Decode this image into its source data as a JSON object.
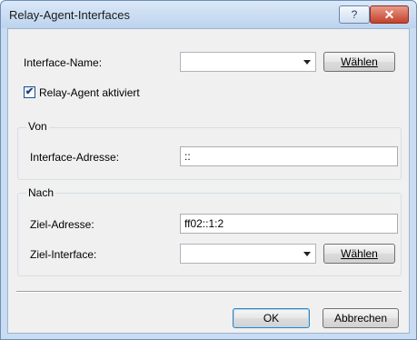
{
  "window": {
    "title": "Relay-Agent-Interfaces",
    "help_label": "?",
    "close_label": "✕"
  },
  "interface_name": {
    "label": "Interface-Name:",
    "value": "",
    "choose_label": "Wählen"
  },
  "relay_agent": {
    "label": "Relay-Agent aktiviert",
    "checked": true,
    "check_glyph": "✔"
  },
  "von": {
    "group_title": "Von",
    "address_label": "Interface-Adresse:",
    "address_value": "::"
  },
  "nach": {
    "group_title": "Nach",
    "target_address_label": "Ziel-Adresse:",
    "target_address_value": "ff02::1:2",
    "target_interface_label": "Ziel-Interface:",
    "target_interface_value": "",
    "choose_label": "Wählen"
  },
  "footer": {
    "ok_label": "OK",
    "cancel_label": "Abbrechen"
  },
  "colors": {
    "title_bar": "#c9dcf2",
    "close_button": "#c4412b",
    "dialog_bg": "#f0f0f0"
  }
}
